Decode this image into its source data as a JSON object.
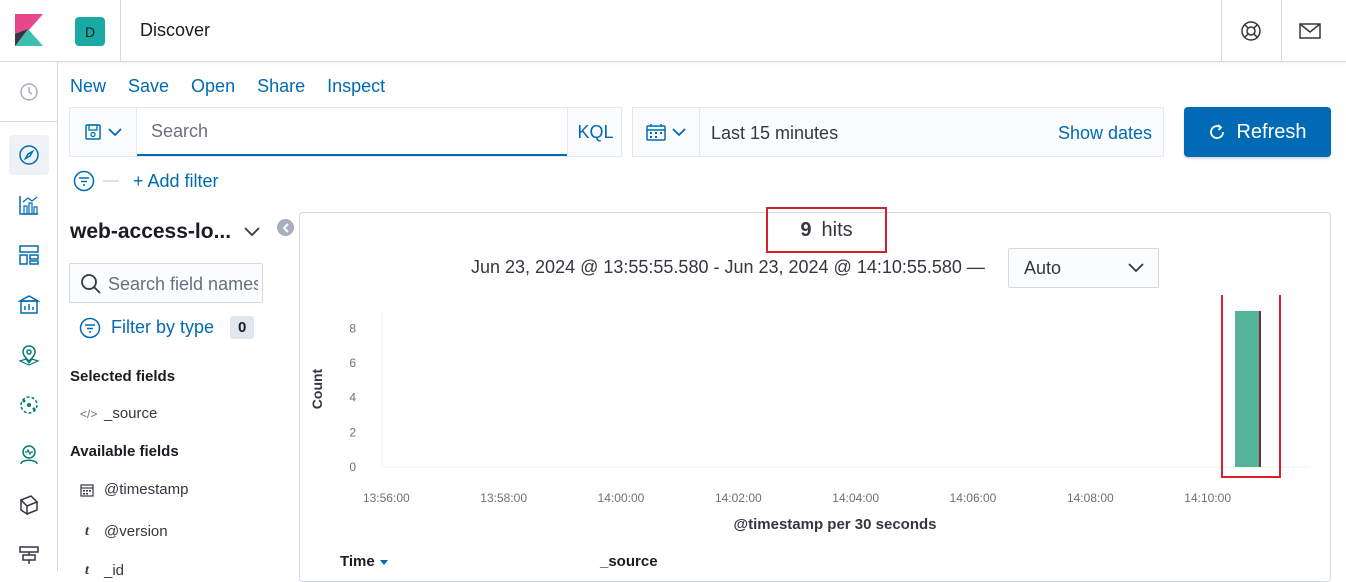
{
  "header": {
    "space_initial": "D",
    "app_title": "Discover"
  },
  "menu": {
    "new": "New",
    "save": "Save",
    "open": "Open",
    "share": "Share",
    "inspect": "Inspect"
  },
  "search": {
    "placeholder": "Search",
    "language": "KQL"
  },
  "date_picker": {
    "range": "Last 15 minutes",
    "show_dates": "Show dates"
  },
  "refresh": {
    "label": "Refresh"
  },
  "filters": {
    "add_filter": "+ Add filter"
  },
  "sidebar": {
    "index_pattern": "web-access-lo...",
    "field_search_placeholder": "Search field names",
    "filter_by_type": "Filter by type",
    "filter_count": "0",
    "selected_fields_label": "Selected fields",
    "selected_fields": [
      {
        "type_icon": "code-icon",
        "name": "_source"
      }
    ],
    "available_fields_label": "Available fields",
    "available_fields": [
      {
        "type_icon": "calendar-icon",
        "name": "@timestamp"
      },
      {
        "type_icon": "t",
        "name": "@version"
      },
      {
        "type_icon": "t",
        "name": "_id"
      }
    ]
  },
  "results": {
    "hits_count": "9",
    "hits_label": "hits",
    "time_range": "Jun 23, 2024 @ 13:55:55.580 - Jun 23, 2024 @ 14:10:55.580 —",
    "interval": "Auto"
  },
  "table": {
    "columns": [
      "Time",
      "_source"
    ]
  },
  "colors": {
    "primary": "#006bb4",
    "bar": "#54b399",
    "highlight": "#d3222a"
  },
  "chart_data": {
    "type": "bar",
    "xlabel": "@timestamp per 30 seconds",
    "ylabel": "Count",
    "ylim": [
      0,
      8
    ],
    "yticks": [
      0,
      2,
      4,
      6,
      8
    ],
    "xticks": [
      "13:56:00",
      "13:58:00",
      "14:00:00",
      "14:02:00",
      "14:04:00",
      "14:06:00",
      "14:08:00",
      "14:10:00"
    ],
    "series": [
      {
        "x": "14:10:30",
        "value": 9
      }
    ]
  }
}
